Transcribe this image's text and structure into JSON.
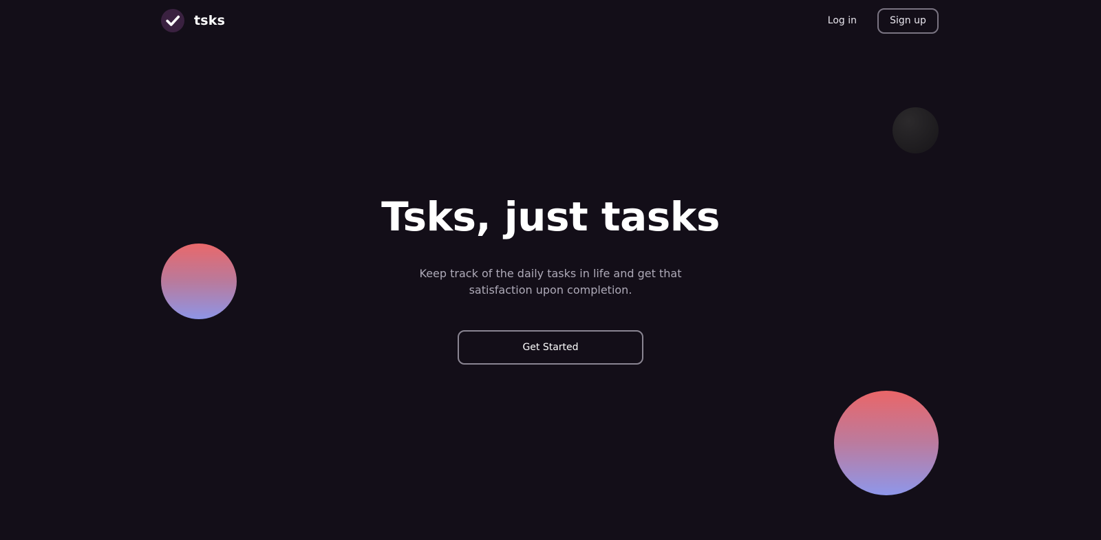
{
  "brand": {
    "name": "tsks",
    "logo_icon": "check-icon",
    "logo_bg_color": "#3a2140"
  },
  "nav": {
    "login_label": "Log in",
    "signup_label": "Sign up"
  },
  "hero": {
    "title": "Tsks, just tasks",
    "subtitle": "Keep track of the daily tasks in life and get that satisfaction upon completion.",
    "cta_label": "Get Started"
  },
  "colors": {
    "background": "#130e18",
    "gradient_top": "#e9686a",
    "gradient_bottom": "#8e95e6"
  }
}
